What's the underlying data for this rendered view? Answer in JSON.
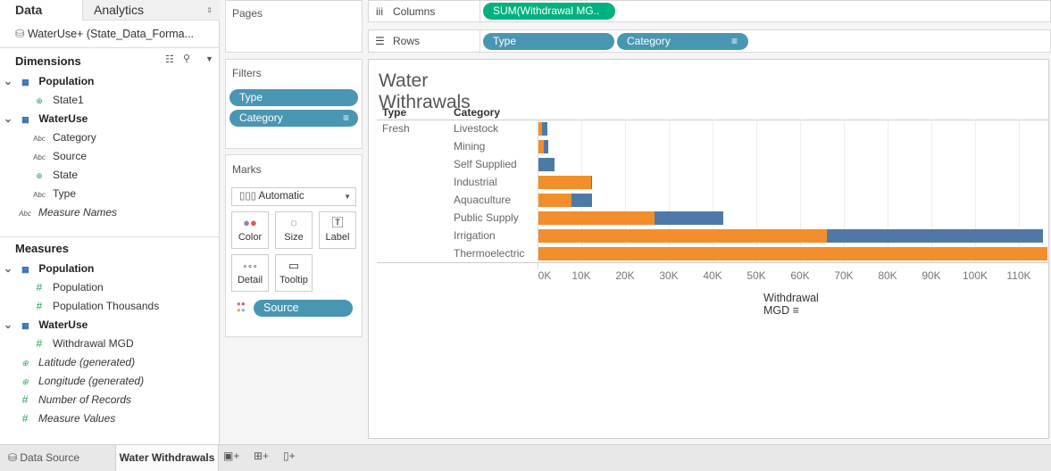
{
  "left": {
    "tab_data": "Data",
    "tab_analytics": "Analytics",
    "datasource": "WaterUse+ (State_Data_Forma...",
    "dimensions_title": "Dimensions",
    "measures_title": "Measures",
    "dims": [
      {
        "label": "Population",
        "kind": "table"
      },
      {
        "label": "State1",
        "kind": "geo"
      },
      {
        "label": "WaterUse",
        "kind": "table"
      },
      {
        "label": "Category",
        "kind": "abc"
      },
      {
        "label": "Source",
        "kind": "abc"
      },
      {
        "label": "State",
        "kind": "geo"
      },
      {
        "label": "Type",
        "kind": "abc"
      },
      {
        "label": "Measure Names",
        "kind": "abc"
      }
    ],
    "meas": [
      {
        "label": "Population",
        "kind": "table"
      },
      {
        "label": "Population",
        "kind": "num"
      },
      {
        "label": "Population Thousands",
        "kind": "num"
      },
      {
        "label": "WaterUse",
        "kind": "table"
      },
      {
        "label": "Withdrawal MGD",
        "kind": "num"
      },
      {
        "label": "Latitude (generated)",
        "kind": "geo"
      },
      {
        "label": "Longitude (generated)",
        "kind": "geo"
      },
      {
        "label": "Number of Records",
        "kind": "num"
      },
      {
        "label": "Measure Values",
        "kind": "num"
      }
    ]
  },
  "pages": {
    "title": "Pages"
  },
  "filters": {
    "title": "Filters",
    "pills": [
      "Type",
      "Category"
    ]
  },
  "marks": {
    "title": "Marks",
    "type": "Automatic",
    "buttons": [
      "Color",
      "Size",
      "Label",
      "Detail",
      "Tooltip"
    ],
    "color_pill": "Source"
  },
  "columns": {
    "label": "Columns",
    "pill": "SUM(Withdrawal MG.."
  },
  "rows": {
    "label": "Rows",
    "pills": [
      "Type",
      "Category"
    ]
  },
  "view": {
    "title": "Water Withrawals",
    "header_type": "Type",
    "header_category": "Category",
    "type_value": "Fresh"
  },
  "chart_data": {
    "type": "bar",
    "orientation": "horizontal",
    "stacked": true,
    "categories": [
      "Livestock",
      "Mining",
      "Self Supplied",
      "Industrial",
      "Aquaculture",
      "Public Supply",
      "Irrigation",
      "Thermoelectric"
    ],
    "series": [
      {
        "color": "#f28e2b",
        "values": [
          0.8,
          1.2,
          0,
          12,
          7.5,
          26.5,
          66,
          117
        ]
      },
      {
        "color": "#4e79a7",
        "values": [
          1.2,
          1.0,
          3.6,
          0.2,
          4.8,
          15.7,
          49.4,
          0
        ]
      }
    ],
    "xlabel": "Withdrawal MGD",
    "xlim": [
      0,
      116.5
    ],
    "xticks": [
      "0K",
      "10K",
      "20K",
      "30K",
      "40K",
      "50K",
      "60K",
      "70K",
      "80K",
      "90K",
      "100K",
      "110K"
    ],
    "grid": true
  },
  "bottom": {
    "data_source": "Data Source",
    "sheet": "Water Withdrawals"
  }
}
